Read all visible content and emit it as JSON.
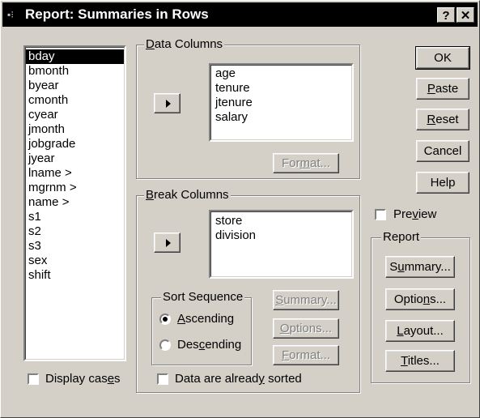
{
  "window": {
    "title": "Report: Summaries in Rows",
    "help_btn": "?",
    "close_btn": "✕"
  },
  "variables": [
    "bday",
    "bmonth",
    "byear",
    "cmonth",
    "cyear",
    "jmonth",
    "jobgrade",
    "jyear",
    "lname  >",
    "mgrnm  >",
    "name  >",
    "s1",
    "s2",
    "s3",
    "sex",
    "shift"
  ],
  "data_columns": {
    "label": "Data Columns",
    "items": [
      "age",
      "tenure",
      "jtenure",
      "salary"
    ],
    "format_btn": "Format..."
  },
  "break_columns": {
    "label": "Break Columns",
    "items": [
      "store",
      "division"
    ]
  },
  "sort_sequence": {
    "label": "Sort Sequence",
    "ascending": "Ascending",
    "descending": "Descending",
    "selected": "Ascending"
  },
  "break_buttons": {
    "summary": "Summary...",
    "options": "Options...",
    "format": "Format..."
  },
  "already_sorted": "Data are already sorted",
  "display_cases": "Display cases",
  "buttons": {
    "ok": "OK",
    "paste": "Paste",
    "reset": "Reset",
    "cancel": "Cancel",
    "help": "Help"
  },
  "preview": "Preview",
  "report": {
    "label": "Report",
    "summary": "Summary...",
    "options": "Options...",
    "layout": "Layout...",
    "titles": "Titles..."
  }
}
